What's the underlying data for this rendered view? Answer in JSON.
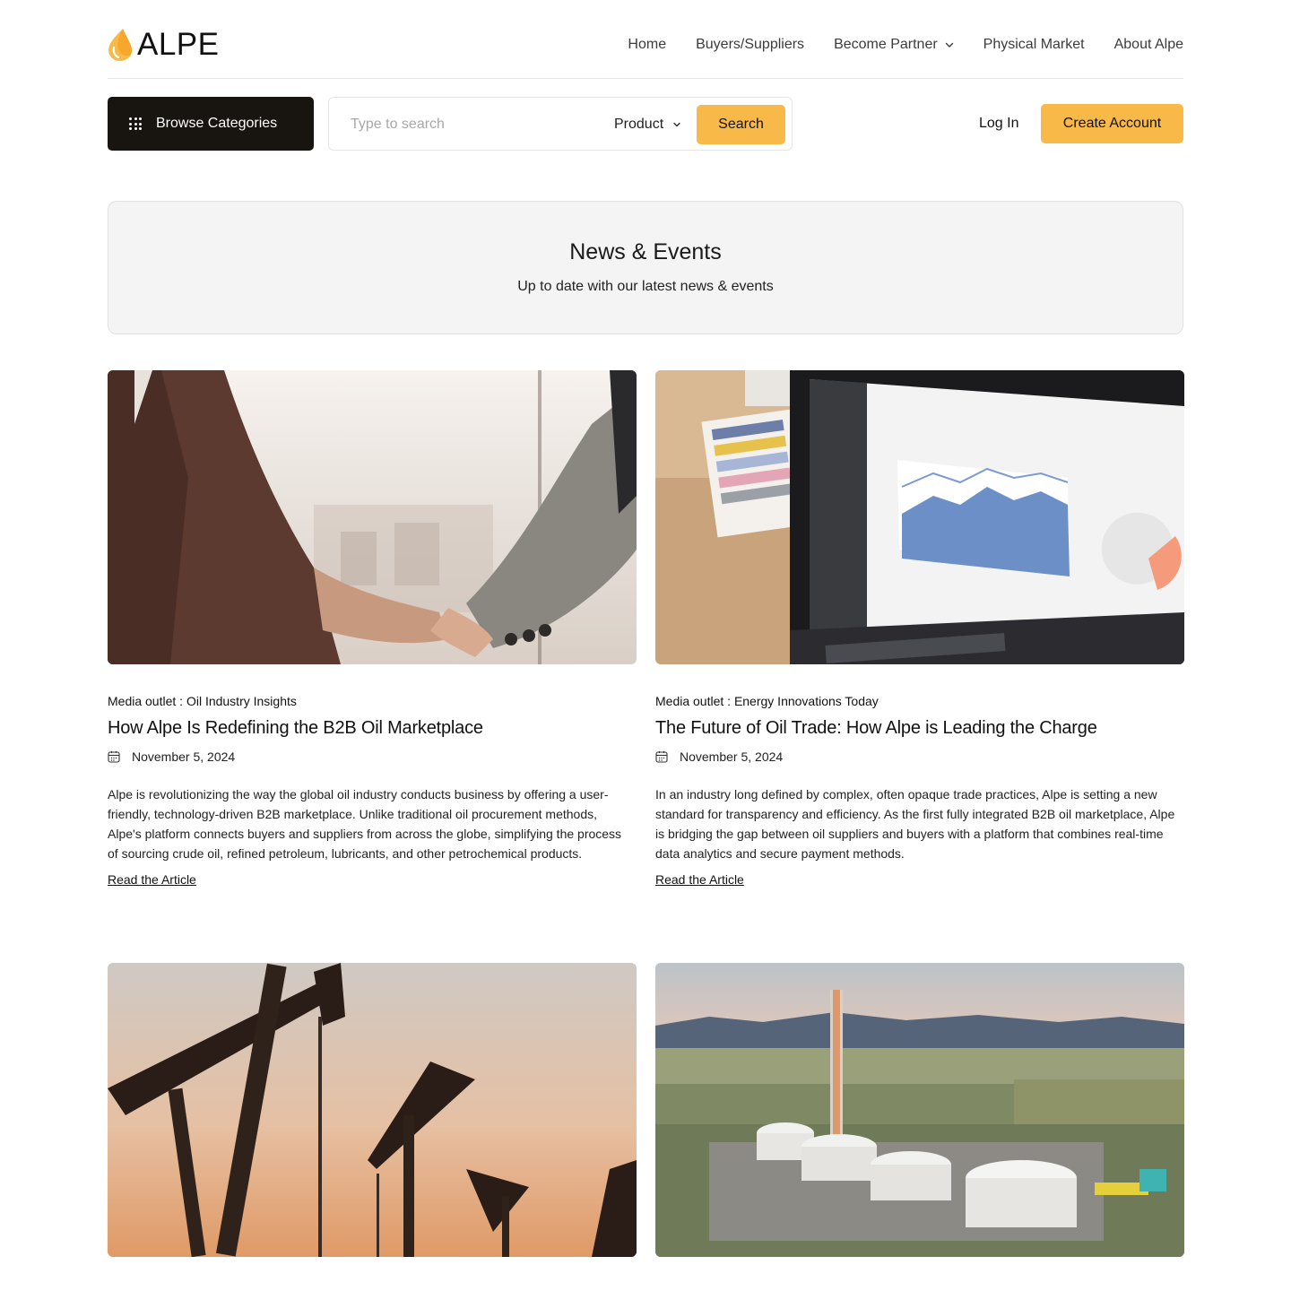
{
  "brand": {
    "name": "ALPE",
    "accent": "#f9b949",
    "dark": "#181410"
  },
  "nav": {
    "items": [
      {
        "label": "Home"
      },
      {
        "label": "Buyers/Suppliers"
      },
      {
        "label": "Become Partner",
        "dropdown": true
      },
      {
        "label": "Physical Market"
      },
      {
        "label": "About Alpe"
      }
    ]
  },
  "toolbar": {
    "browse_label": "Browse Categories",
    "search_placeholder": "Type to search",
    "search_scope": "Product",
    "search_label": "Search",
    "login_label": "Log In",
    "create_account_label": "Create Account"
  },
  "hero": {
    "title": "News & Events",
    "subtitle": "Up to date with our latest news & events"
  },
  "articles": [
    {
      "image": "handshake-business-photo",
      "outlet": "Media outlet : Oil Industry Insights",
      "title": "How Alpe Is Redefining the B2B Oil Marketplace",
      "date": "November 5, 2024",
      "body": "Alpe is revolutionizing the way the global oil industry conducts business by offering a user-friendly, technology-driven B2B marketplace. Unlike traditional oil procurement methods, Alpe's platform connects buyers and suppliers from across the globe, simplifying the process of sourcing crude oil, refined petroleum, lubricants, and other petrochemical products.",
      "link_label": "Read the Article"
    },
    {
      "image": "laptop-dashboard-photo",
      "outlet": "Media outlet : Energy Innovations Today",
      "title": "The Future of Oil Trade: How Alpe is Leading the Charge",
      "date": "November 5, 2024",
      "body": "In an industry long defined by complex, often opaque trade practices, Alpe is setting a new standard for transparency and efficiency. As the first fully integrated B2B oil marketplace, Alpe is bridging the gap between oil suppliers and buyers with a platform that combines real-time data analytics and secure payment methods.",
      "link_label": "Read the Article"
    },
    {
      "image": "pumpjacks-sunset-photo"
    },
    {
      "image": "oil-storage-tanks-aerial-photo"
    }
  ]
}
